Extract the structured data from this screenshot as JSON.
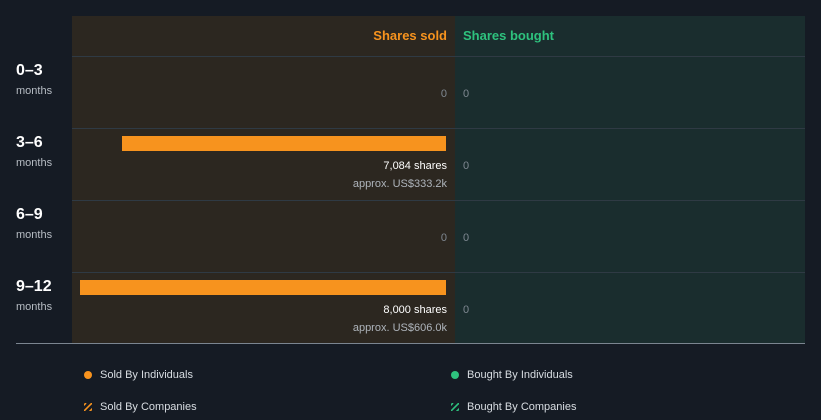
{
  "chart_data": {
    "type": "bar",
    "orientation": "horizontal",
    "columns": [
      "Shares sold",
      "Shares bought"
    ],
    "categories": [
      {
        "range": "0–3",
        "unit": "months"
      },
      {
        "range": "3–6",
        "unit": "months"
      },
      {
        "range": "6–9",
        "unit": "months"
      },
      {
        "range": "9–12",
        "unit": "months"
      }
    ],
    "series": [
      {
        "name": "Shares sold",
        "values": [
          0,
          7084,
          0,
          8000
        ],
        "labels": [
          "0",
          "7,084 shares",
          "0",
          "8,000 shares"
        ],
        "approx": [
          "",
          "approx. US$333.2k",
          "",
          "approx. US$606.0k"
        ],
        "color": "#f7931e"
      },
      {
        "name": "Shares bought",
        "values": [
          0,
          0,
          0,
          0
        ],
        "labels": [
          "0",
          "0",
          "0",
          "0"
        ],
        "color": "#2ec27e"
      }
    ],
    "xlim": [
      0,
      8000
    ],
    "legend": [
      {
        "label": "Sold By Individuals",
        "color": "#f7931e",
        "marker": "dot"
      },
      {
        "label": "Bought By Individuals",
        "color": "#2ec27e",
        "marker": "dot"
      },
      {
        "label": "Sold By Companies",
        "color": "#f7931e",
        "marker": "hatch"
      },
      {
        "label": "Bought By Companies",
        "color": "#2ec27e",
        "marker": "hatch"
      }
    ],
    "legend_position": "bottom"
  }
}
